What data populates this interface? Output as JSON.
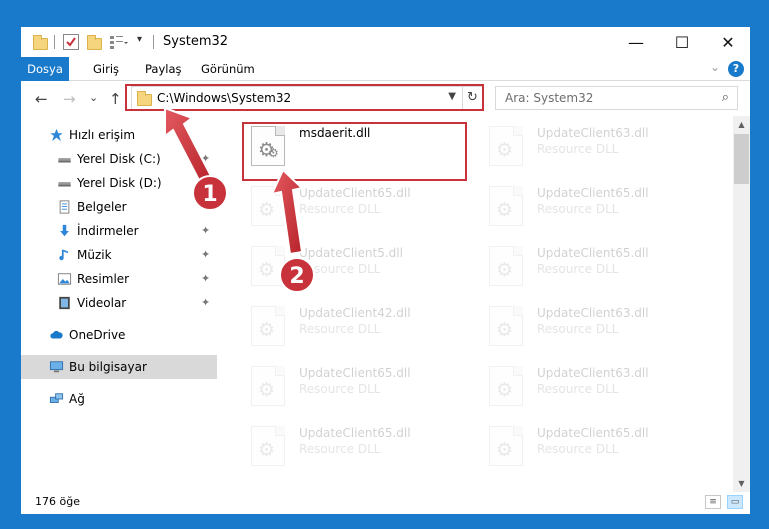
{
  "window": {
    "title": "System32",
    "minimize_glyph": "—",
    "maximize_glyph": "☐",
    "close_glyph": "✕"
  },
  "ribbon": {
    "tabs": [
      {
        "label": "Dosya",
        "active": true
      },
      {
        "label": "Giriş",
        "active": false
      },
      {
        "label": "Paylaş",
        "active": false
      },
      {
        "label": "Görünüm",
        "active": false
      }
    ],
    "help_glyph": "?",
    "collapse_glyph": "⌄"
  },
  "navigation": {
    "back_glyph": "←",
    "forward_glyph": "→",
    "recent_glyph": "⌄",
    "up_glyph": "↑",
    "address": "C:\\Windows\\System32",
    "refresh_glyph": "↻",
    "search_placeholder": "Ara: System32"
  },
  "sidebar": {
    "items": [
      {
        "label": "Hızlı erişim",
        "icon": "star-icon",
        "pinned": false
      },
      {
        "label": "Yerel Disk (C:)",
        "icon": "drive-icon",
        "pinned": true
      },
      {
        "label": "Yerel Disk (D:)",
        "icon": "drive-icon",
        "pinned": false
      },
      {
        "label": "Belgeler",
        "icon": "documents-icon",
        "pinned": true
      },
      {
        "label": "İndirmeler",
        "icon": "downloads-icon",
        "pinned": true
      },
      {
        "label": "Müzik",
        "icon": "music-icon",
        "pinned": true
      },
      {
        "label": "Resimler",
        "icon": "pictures-icon",
        "pinned": true
      },
      {
        "label": "Videolar",
        "icon": "videos-icon",
        "pinned": true
      },
      {
        "label": "OneDrive",
        "icon": "cloud-icon",
        "pinned": false
      },
      {
        "label": "Bu bilgisayar",
        "icon": "computer-icon",
        "pinned": false,
        "selected": true
      },
      {
        "label": "Ağ",
        "icon": "network-icon",
        "pinned": false
      }
    ],
    "pin_glyph": "✦"
  },
  "files": [
    {
      "name": "msdaerit.dll",
      "type": "",
      "highlighted": true
    },
    {
      "name": "UpdateClient63.dll",
      "type": "Resource DLL"
    },
    {
      "name": "UpdateClient65.dll",
      "type": "Resource DLL"
    },
    {
      "name": "UpdateClient65.dll",
      "type": "Resource DLL"
    },
    {
      "name": "UpdateClient5.dll",
      "type": "Resource DLL"
    },
    {
      "name": "UpdateClient65.dll",
      "type": "Resource DLL"
    },
    {
      "name": "UpdateClient42.dll",
      "type": "Resource DLL"
    },
    {
      "name": "UpdateClient63.dll",
      "type": "Resource DLL"
    },
    {
      "name": "UpdateClient65.dll",
      "type": "Resource DLL"
    },
    {
      "name": "UpdateClient63.dll",
      "type": "Resource DLL"
    },
    {
      "name": "UpdateClient65.dll",
      "type": "Resource DLL"
    },
    {
      "name": "UpdateClient65.dll",
      "type": "Resource DLL"
    }
  ],
  "status": {
    "item_count": "176 öğe"
  },
  "annotations": {
    "step1": "1",
    "step2": "2",
    "color": "#c8323a"
  },
  "colors": {
    "accent": "#1979ca",
    "highlight_red": "#c8323a"
  }
}
